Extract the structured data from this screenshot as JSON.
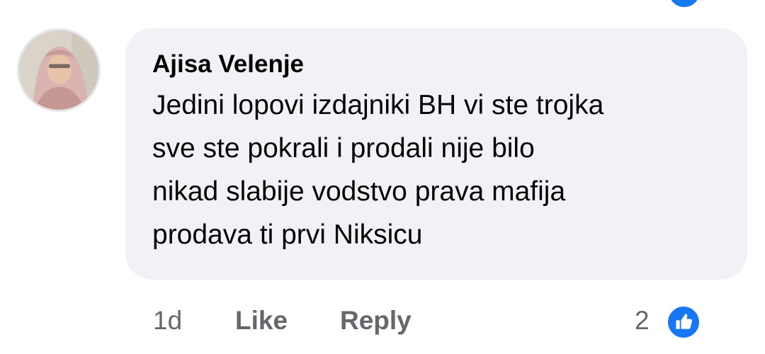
{
  "comment": {
    "author": "Ajisa Velenje",
    "lines": [
      "Jedini lopovi izdajniki BH vi ste trojka",
      "sve ste pokrali i prodali nije bilo",
      "nikad slabije vodstvo prava mafija",
      "prodava ti prvi Niksicu"
    ],
    "time": "1d",
    "like_label": "Like",
    "reply_label": "Reply",
    "reaction_count": "2",
    "reaction_icon": "thumbs-up-icon"
  },
  "colors": {
    "bubble_bg": "#f0f2f5",
    "text": "#050505",
    "secondary_text": "#65676b",
    "like_blue": "#1877f2"
  }
}
